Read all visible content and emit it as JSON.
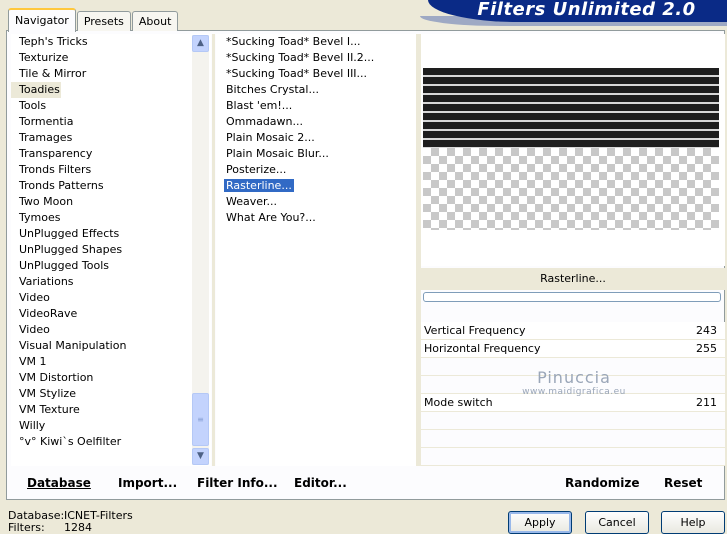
{
  "tabs": [
    {
      "label": "Navigator",
      "active": true
    },
    {
      "label": "Presets",
      "active": false
    },
    {
      "label": "About",
      "active": false
    }
  ],
  "app_title": "Filters Unlimited 2.0",
  "categories": [
    "Teph's Tricks",
    "Texturize",
    "Tile & Mirror",
    "Toadies",
    "Tools",
    "Tormentia",
    "Tramages",
    "Transparency",
    "Tronds Filters",
    "Tronds Patterns",
    "Two Moon",
    "Tymoes",
    "UnPlugged Effects",
    "UnPlugged Shapes",
    "UnPlugged Tools",
    "Variations",
    "Video",
    "VideoRave",
    "Video",
    "Visual Manipulation",
    "VM 1",
    "VM Distortion",
    "VM Stylize",
    "VM Texture",
    "Willy",
    "°v° Kiwi`s Oelfilter"
  ],
  "selected_category": "Toadies",
  "filters": [
    "*Sucking Toad*  Bevel I...",
    "*Sucking Toad*  Bevel II.2...",
    "*Sucking Toad*  Bevel III...",
    "Bitches Crystal...",
    "Blast 'em!...",
    "Ommadawn...",
    "Plain Mosaic 2...",
    "Plain Mosaic Blur...",
    "Posterize...",
    "Rasterline...",
    "Weaver...",
    "What Are You?..."
  ],
  "selected_filter": "Rasterline...",
  "filter_title": "Rasterline...",
  "params": [
    {
      "label": "Vertical Frequency",
      "value": "243"
    },
    {
      "label": "Horizontal Frequency",
      "value": "255"
    },
    {
      "label": "",
      "value": ""
    },
    {
      "label": "",
      "value": ""
    },
    {
      "label": "Mode switch",
      "value": "211"
    },
    {
      "label": "",
      "value": ""
    },
    {
      "label": "",
      "value": ""
    },
    {
      "label": "",
      "value": ""
    }
  ],
  "watermark": {
    "line1": "Pinuccia",
    "line2": "www.maidigrafica.eu"
  },
  "bottom_buttons": {
    "database": "Database",
    "import": "Import...",
    "filter_info": "Filter Info...",
    "editor": "Editor...",
    "randomize": "Randomize",
    "reset": "Reset"
  },
  "status": {
    "database_label": "Database:",
    "database_value": "ICNET-Filters",
    "filters_label": "Filters:",
    "filters_value": "1284"
  },
  "dialog_buttons": {
    "apply": "Apply",
    "cancel": "Cancel",
    "help": "Help"
  },
  "scroll_icons": {
    "up": "▲",
    "down": "▼",
    "grip": "≡"
  }
}
